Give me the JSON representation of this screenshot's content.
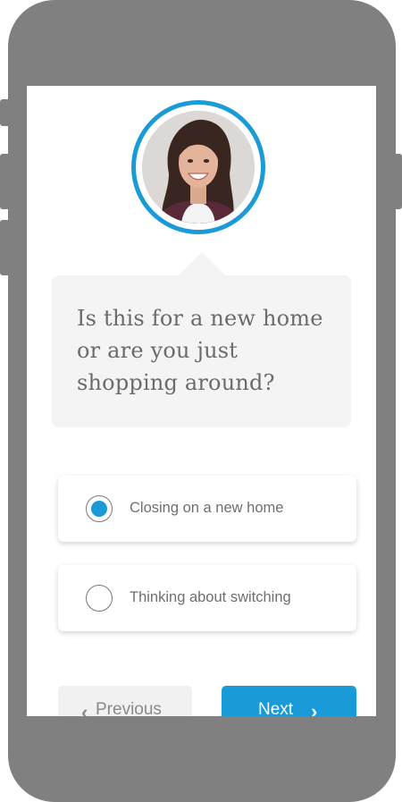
{
  "question": {
    "text": "Is this for a new home or are you just shopping around?"
  },
  "options": [
    {
      "label": "Closing on a new home",
      "selected": true
    },
    {
      "label": "Thinking about switching",
      "selected": false
    }
  ],
  "nav": {
    "previous_label": "Previous",
    "previous_icon": "chevron-left-icon",
    "next_label": "Next",
    "next_icon": "chevron-right-icon"
  },
  "colors": {
    "accent": "#1a9ad6",
    "device_frame": "#808080",
    "bubble": "#f4f4f4"
  }
}
